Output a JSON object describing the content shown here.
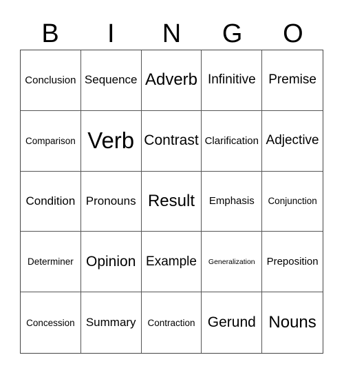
{
  "header": [
    "B",
    "I",
    "N",
    "G",
    "O"
  ],
  "rows": [
    [
      "Conclusion",
      "Sequence",
      "Adverb",
      "Infinitive",
      "Premise"
    ],
    [
      "Comparison",
      "Verb",
      "Contrast",
      "Clarification",
      "Adjective"
    ],
    [
      "Condition",
      "Pronouns",
      "Result",
      "Emphasis",
      "Conjunction"
    ],
    [
      "Determiner",
      "Opinion",
      "Example",
      "Generalization",
      "Preposition"
    ],
    [
      "Concession",
      "Summary",
      "Contraction",
      "Gerund",
      "Nouns"
    ]
  ]
}
